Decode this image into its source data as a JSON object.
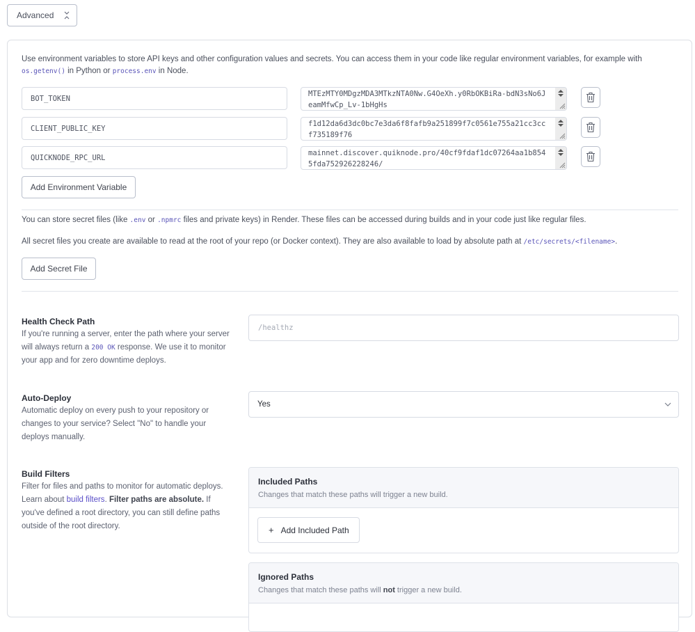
{
  "advanced_toggle": {
    "label": "Advanced",
    "icon": "chevrons-collapse-icon"
  },
  "env_vars": {
    "intro_part1": "Use environment variables to store API keys and other configuration values and secrets. You can access them in your code like regular environment variables, for example with ",
    "intro_code1": "os.getenv()",
    "intro_part2": " in Python or ",
    "intro_code2": "process.env",
    "intro_part3": " in Node.",
    "rows": [
      {
        "key": "BOT_TOKEN",
        "value": "MTEzMTY0MDgzMDA3MTkzNTA0Nw.G4OeXh.y0RbOKBiRa-bdN3sNo6JeamMfwCp_Lv-1bHgHs"
      },
      {
        "key": "CLIENT_PUBLIC_KEY",
        "value": "f1d12da6d3dc0bc7e3da6f8fafb9a251899f7c0561e755a21cc3ccf735189f76"
      },
      {
        "key": "QUICKNODE_RPC_URL",
        "value": "mainnet.discover.quiknode.pro/40cf9fdaf1dc07264aa1b8545fda752926228246/"
      }
    ],
    "delete_icon": "trash-icon",
    "add_button": "Add Environment Variable"
  },
  "secret_files": {
    "p1_part1": "You can store secret files (like ",
    "p1_code1": ".env",
    "p1_part2": " or ",
    "p1_code2": ".npmrc",
    "p1_part3": " files and private keys) in Render. These files can be accessed during builds and in your code just like regular files.",
    "p2_part1": "All secret files you create are available to read at the root of your repo (or Docker context). They are also available to load by absolute path at ",
    "p2_code": "/etc/secrets/<filename>",
    "p2_part2": ".",
    "add_button": "Add Secret File"
  },
  "health_check": {
    "title": "Health Check Path",
    "desc_part1": "If you're running a server, enter the path where your server will always return a ",
    "desc_code": "200 OK",
    "desc_part2": " response. We use it to monitor your app and for zero downtime deploys.",
    "placeholder": "/healthz"
  },
  "auto_deploy": {
    "title": "Auto-Deploy",
    "desc": "Automatic deploy on every push to your repository or changes to your service? Select \"No\" to handle your deploys manually.",
    "selected": "Yes"
  },
  "build_filters": {
    "title": "Build Filters",
    "desc_part1": "Filter for files and paths to monitor for automatic deploys. Learn about ",
    "desc_link": "build filters",
    "desc_part2": ". ",
    "desc_bold": "Filter paths are absolute.",
    "desc_part3": " If you've defined a root directory, you can still define paths outside of the root directory.",
    "included": {
      "title": "Included Paths",
      "subtitle": "Changes that match these paths will trigger a new build.",
      "add_button": "Add Included Path"
    },
    "ignored": {
      "title": "Ignored Paths",
      "subtitle_part1": "Changes that match these paths will ",
      "subtitle_bold": "not",
      "subtitle_part2": " trigger a new build."
    }
  }
}
